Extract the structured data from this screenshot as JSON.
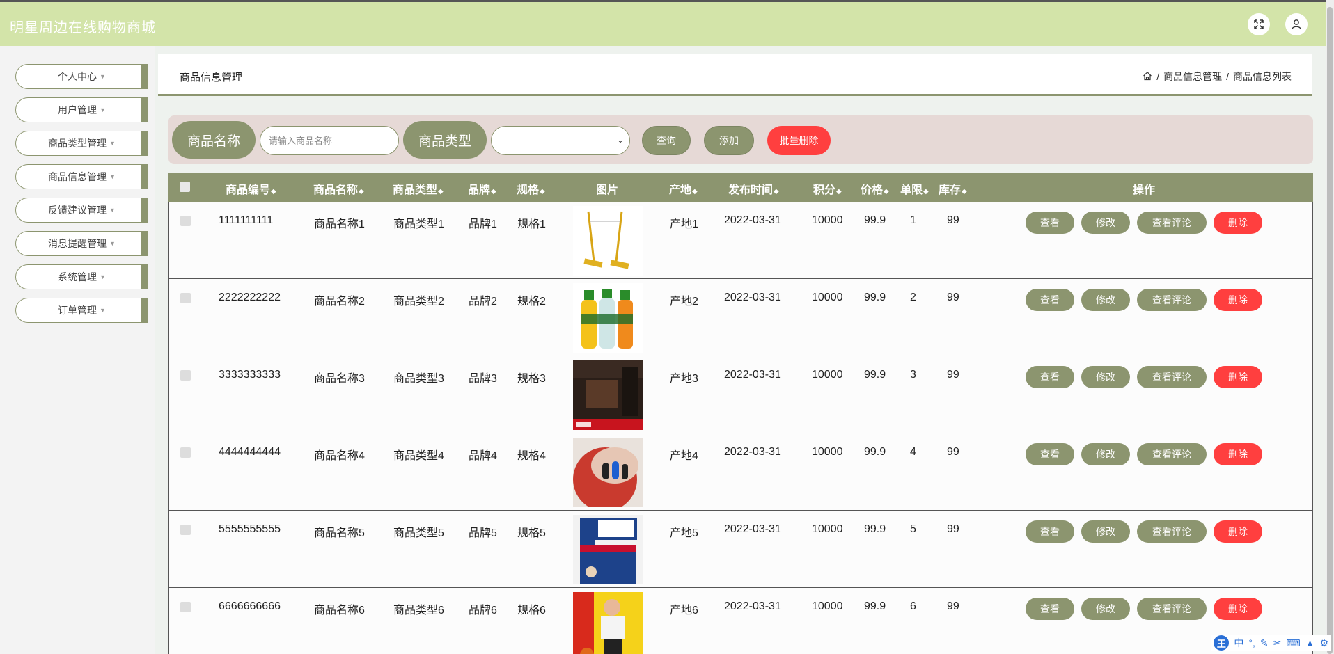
{
  "header": {
    "title": "明星周边在线购物商城"
  },
  "sidebar": {
    "items": [
      {
        "label": "个人中心"
      },
      {
        "label": "用户管理"
      },
      {
        "label": "商品类型管理"
      },
      {
        "label": "商品信息管理"
      },
      {
        "label": "反馈建议管理"
      },
      {
        "label": "消息提醒管理"
      },
      {
        "label": "系统管理"
      },
      {
        "label": "订单管理"
      }
    ]
  },
  "page": {
    "title": "商品信息管理",
    "breadcrumb": [
      "商品信息管理",
      "商品信息列表"
    ],
    "breadcrumb_sep": "/"
  },
  "search": {
    "name_label": "商品名称",
    "name_placeholder": "请输入商品名称",
    "type_label": "商品类型",
    "type_value": "",
    "query_button": "查询",
    "add_button": "添加",
    "batch_delete_button": "批量删除"
  },
  "table": {
    "columns": [
      "商品编号",
      "商品名称",
      "商品类型",
      "品牌",
      "规格",
      "图片",
      "产地",
      "发布时间",
      "积分",
      "价格",
      "单限",
      "库存",
      "操作"
    ],
    "rows": [
      {
        "code": "1111111111",
        "name": "商品名称1",
        "type": "商品类型1",
        "brand": "品牌1",
        "spec": "规格1",
        "image": "basketball-stand",
        "origin": "产地1",
        "date": "2022-03-31",
        "points": "10000",
        "price": "99.9",
        "limit": "1",
        "stock": "99"
      },
      {
        "code": "2222222222",
        "name": "商品名称2",
        "type": "商品类型2",
        "brand": "品牌2",
        "spec": "规格2",
        "image": "sports-drinks",
        "origin": "产地2",
        "date": "2022-03-31",
        "points": "10000",
        "price": "99.9",
        "limit": "2",
        "stock": "99"
      },
      {
        "code": "3333333333",
        "name": "商品名称3",
        "type": "商品类型3",
        "brand": "品牌3",
        "spec": "规格3",
        "image": "nba-book-dark",
        "origin": "产地3",
        "date": "2022-03-31",
        "points": "10000",
        "price": "99.9",
        "limit": "3",
        "stock": "99"
      },
      {
        "code": "4444444444",
        "name": "商品名称4",
        "type": "商品类型4",
        "brand": "品牌4",
        "spec": "规格4",
        "image": "finger-sleeves",
        "origin": "产地4",
        "date": "2022-03-31",
        "points": "10000",
        "price": "99.9",
        "limit": "4",
        "stock": "99"
      },
      {
        "code": "5555555555",
        "name": "商品名称5",
        "type": "商品类型5",
        "brand": "品牌5",
        "spec": "规格5",
        "image": "nba-training-book",
        "origin": "产地5",
        "date": "2022-03-31",
        "points": "10000",
        "price": "99.9",
        "limit": "5",
        "stock": "99"
      },
      {
        "code": "6666666666",
        "name": "商品名称6",
        "type": "商品类型6",
        "brand": "品牌6",
        "spec": "规格6",
        "image": "dribbling-player",
        "origin": "产地6",
        "date": "2022-03-31",
        "points": "10000",
        "price": "99.9",
        "limit": "6",
        "stock": "99"
      }
    ],
    "row_actions": {
      "view": "查看",
      "edit": "修改",
      "reviews": "查看评论",
      "delete": "删除"
    }
  },
  "ime": {
    "label": "中"
  },
  "colors": {
    "accent": "#8c956f",
    "header_bg": "#d3e4a9",
    "danger": "#ff3f3f",
    "search_bg": "#e6d9d6"
  }
}
